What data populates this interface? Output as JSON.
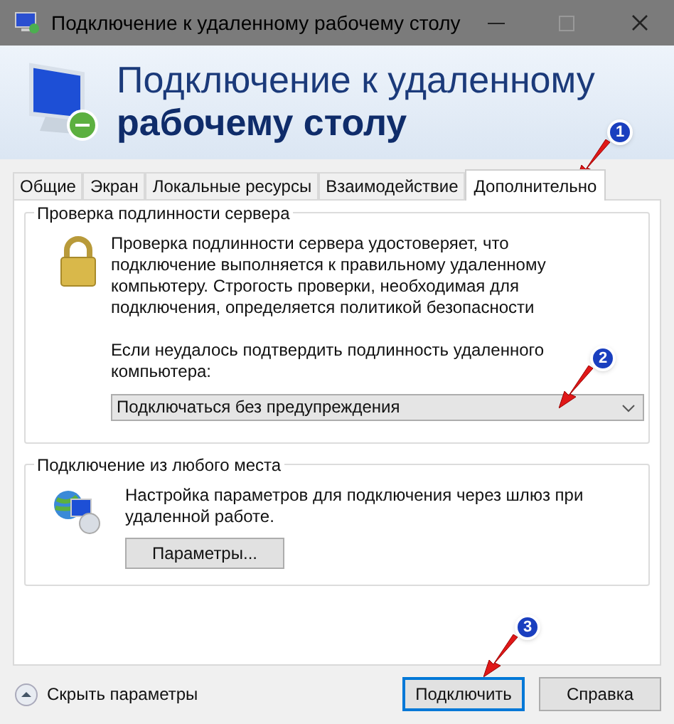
{
  "window": {
    "title": "Подключение к удаленному рабочему столу"
  },
  "header": {
    "line_1": "Подключение к удаленному",
    "line_2": "рабочему столу"
  },
  "tabs": [
    {
      "label": "Общие",
      "selected": false
    },
    {
      "label": "Экран",
      "selected": false
    },
    {
      "label": "Локальные ресурсы",
      "selected": false
    },
    {
      "label": "Взаимодействие",
      "selected": false
    },
    {
      "label": "Дополнительно",
      "selected": true
    }
  ],
  "server_auth": {
    "title": "Проверка подлинности сервера",
    "description": "Проверка подлинности сервера удостоверяет, что подключение выполняется к правильному удаленному компьютеру. Строгость проверки, необходимая для подключения, определяется политикой безопасности",
    "prompt": "Если неудалось подтвердить подлинность удаленного компьютера:",
    "dropdown": {
      "value": "Подключаться без предупреждения"
    }
  },
  "gateway": {
    "title": "Подключение из любого места",
    "description": "Настройка параметров для подключения через шлюз при удаленной работе.",
    "button": "Параметры..."
  },
  "footer": {
    "toggle": "Скрыть параметры",
    "buttons": [
      {
        "label": "Подключить",
        "selected": true
      },
      {
        "label": "Справка",
        "selected": false
      }
    ]
  },
  "annotations": [
    {
      "number": "1"
    },
    {
      "number": "2"
    },
    {
      "number": "3"
    }
  ]
}
